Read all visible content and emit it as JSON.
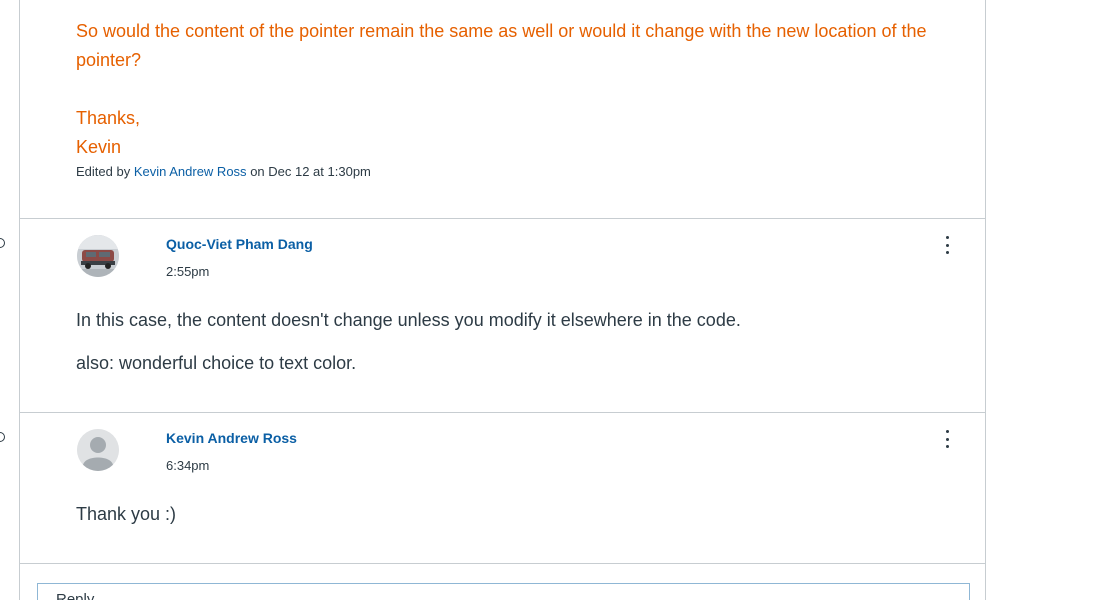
{
  "first_post": {
    "question": "So would the content of the pointer remain the same as well or would it change with the new location of the pointer?",
    "signoff": "Thanks,",
    "signature": "Kevin",
    "edited_prefix": "Edited by",
    "edited_author": "Kevin Andrew Ross",
    "edited_suffix": "on Dec 12 at 1:30pm"
  },
  "replies": [
    {
      "author": "Quoc-Viet Pham Dang",
      "time": "2:55pm",
      "paragraphs": [
        "In this case, the content doesn't change unless you modify it elsewhere in the code.",
        "also: wonderful choice to text color."
      ]
    },
    {
      "author": "Kevin Andrew Ross",
      "time": "6:34pm",
      "paragraphs": [
        "Thank you :)"
      ]
    }
  ],
  "reply_box": {
    "label": "Reply"
  },
  "colors": {
    "highlight_text": "#e66000",
    "link": "#0b5fa5",
    "divider": "#c7cdd1"
  },
  "icons": {
    "menu": "more-vertical-icon",
    "avatar_placeholder": "person-icon"
  }
}
